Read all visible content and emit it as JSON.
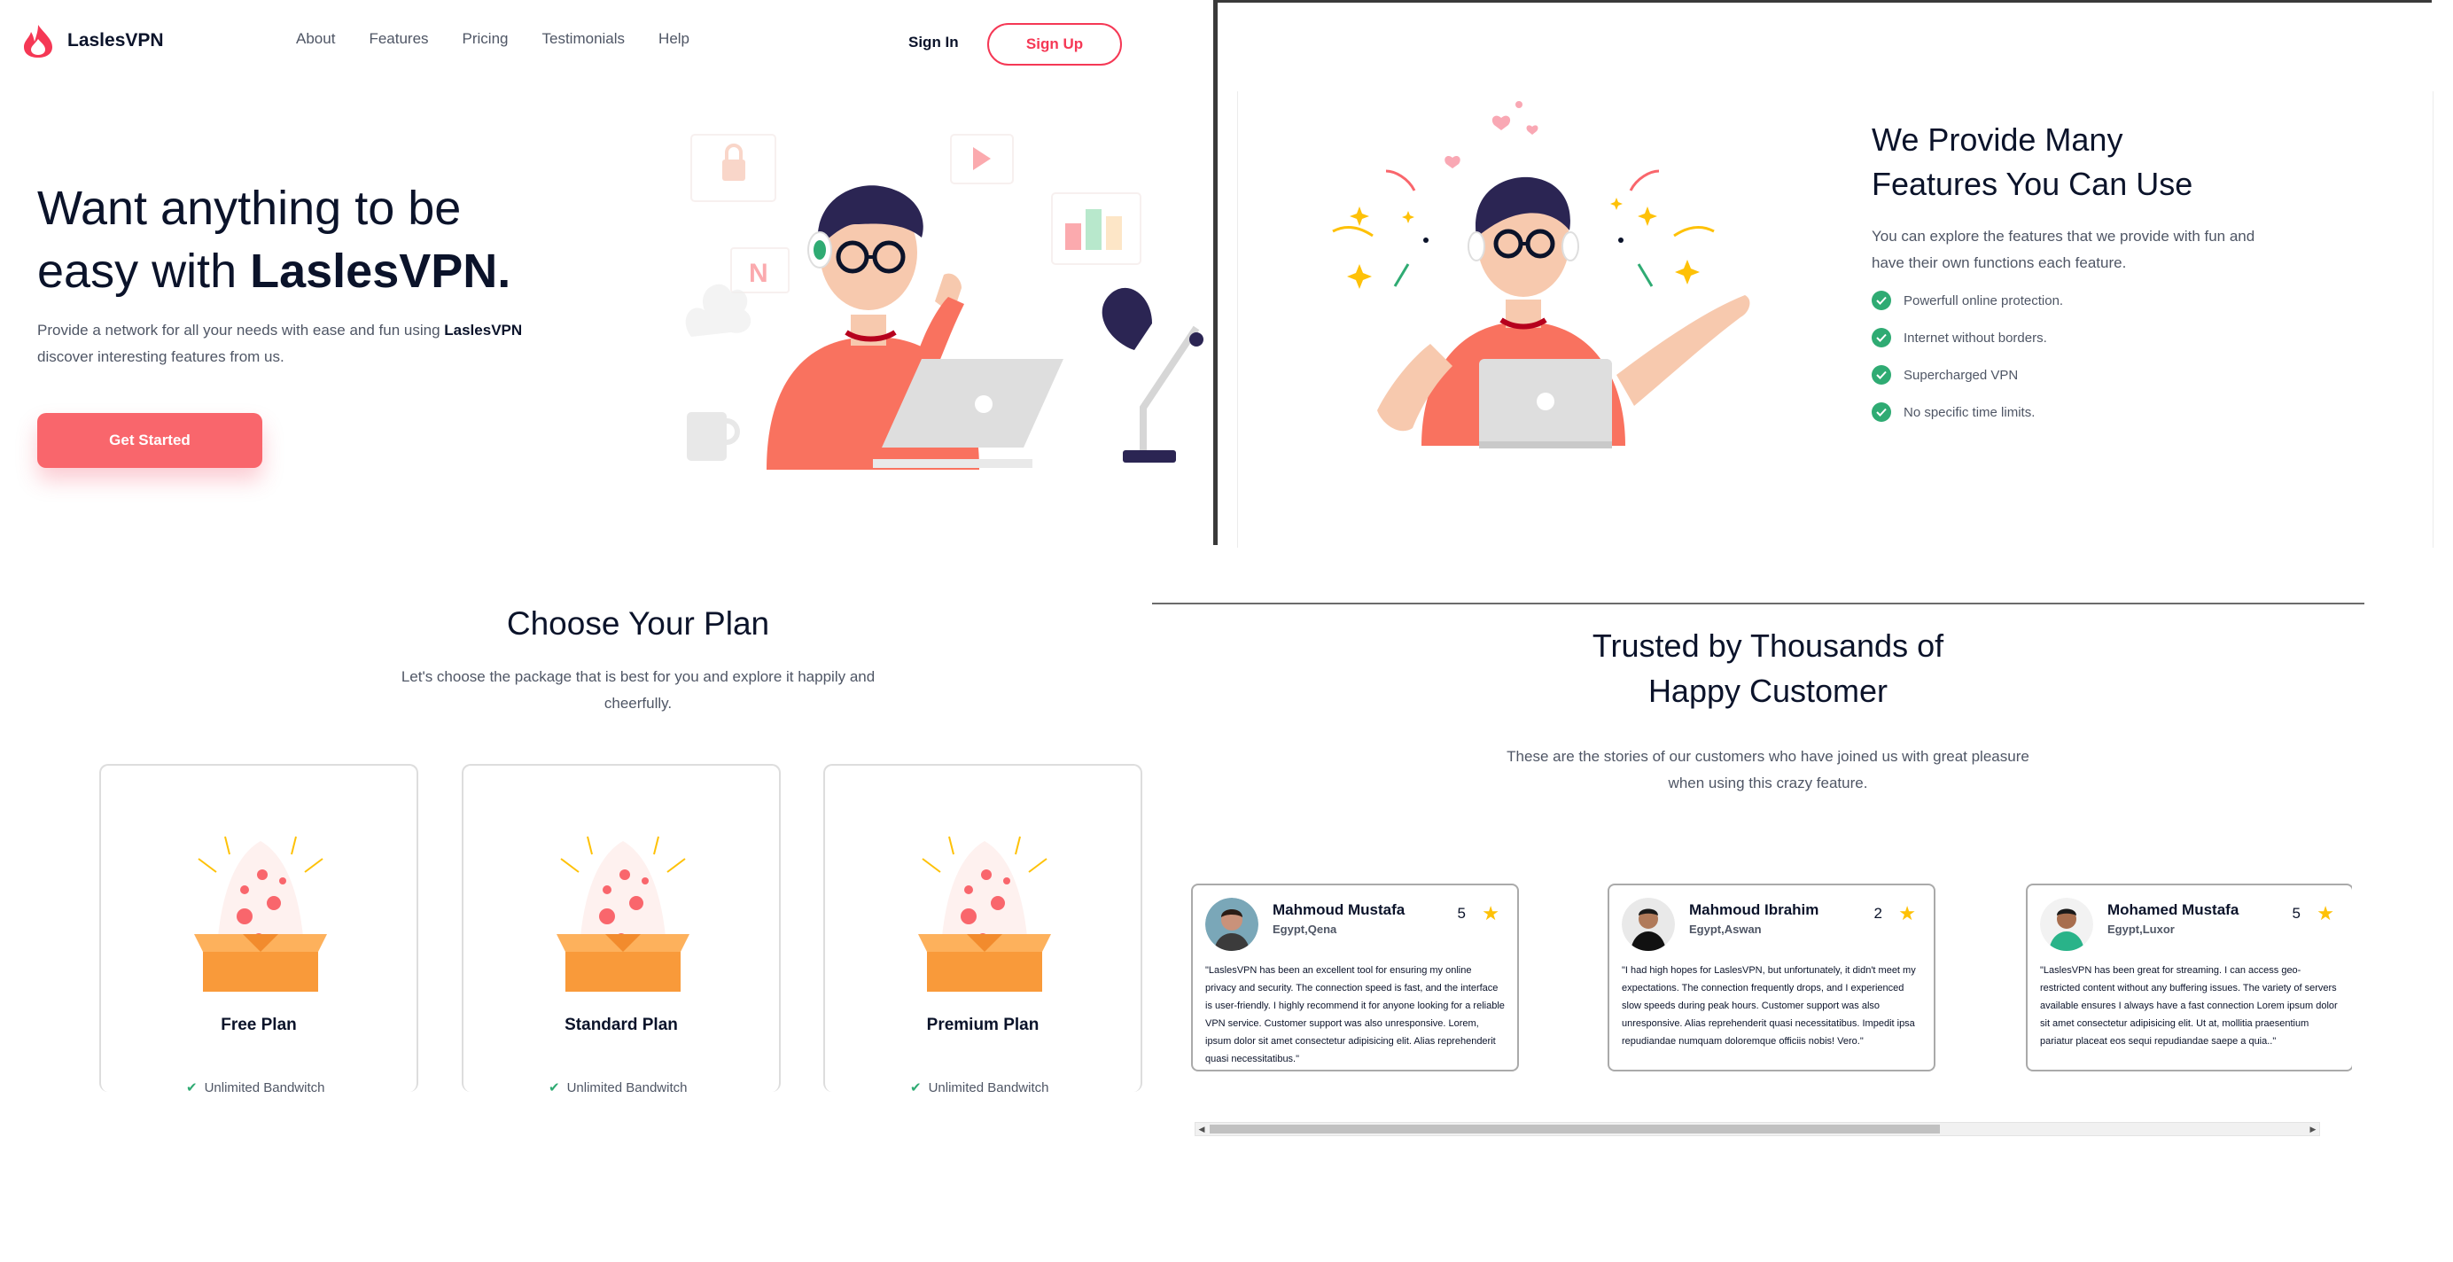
{
  "header": {
    "brand_name": "LaslesVPN",
    "nav": [
      "About",
      "Features",
      "Pricing",
      "Testimonials",
      "Help"
    ],
    "sign_in": "Sign In",
    "sign_up": "Sign Up"
  },
  "hero": {
    "title_line1": "Want anything to be",
    "title_line2_prefix": "easy with ",
    "title_line2_brand": "LaslesVPN.",
    "desc_prefix": "Provide a network for all your needs with ease and fun using ",
    "desc_brand": "LaslesVPN",
    "desc_line2": "discover interesting features from us.",
    "cta": "Get Started",
    "art_letter": "N"
  },
  "features": {
    "title_line1": "We Provide Many",
    "title_line2": "Features You Can Use",
    "desc": "You can explore the features that we provide with fun and have their own functions each feature.",
    "items": [
      "Powerfull online protection.",
      "Internet without borders.",
      "Supercharged VPN",
      "No specific time limits."
    ]
  },
  "pricing": {
    "title": "Choose Your Plan",
    "subtitle": "Let's choose the package that is best for you and explore it happily and cheerfully.",
    "plans": [
      {
        "name": "Free Plan",
        "feature": "Unlimited Bandwitch"
      },
      {
        "name": "Standard Plan",
        "feature": "Unlimited Bandwitch"
      },
      {
        "name": "Premium Plan",
        "feature": "Unlimited Bandwitch"
      }
    ]
  },
  "testimonials": {
    "title_line1": "Trusted by Thousands of",
    "title_line2": "Happy Customer",
    "subtitle": "These are the stories of our customers who have joined us with great pleasure when using this crazy feature.",
    "reviews": [
      {
        "name": "Mahmoud Mustafa",
        "location": "Egypt,Qena",
        "score": "5",
        "quote": "\"LaslesVPN has been an excellent tool for ensuring my online privacy and security. The connection speed is fast, and the interface is user-friendly. I highly recommend it for anyone looking for a reliable VPN service. Customer support was also unresponsive. Lorem, ipsum dolor sit amet consectetur adipisicing elit. Alias reprehenderit quasi necessitatibus.\""
      },
      {
        "name": "Mahmoud Ibrahim",
        "location": "Egypt,Aswan",
        "score": "2",
        "quote": "\"I had high hopes for LaslesVPN, but unfortunately, it didn't meet my expectations. The connection frequently drops, and I experienced slow speeds during peak hours. Customer support was also unresponsive. Alias reprehenderit quasi necessitatibus. Impedit ipsa repudiandae numquam doloremque officiis nobis! Vero.\""
      },
      {
        "name": "Mohamed Mustafa",
        "location": "Egypt,Luxor",
        "score": "5",
        "quote": "\"LaslesVPN has been great for streaming. I can access geo-restricted content without any buffering issues. The variety of servers available ensures I always have a fast connection Lorem ipsum dolor sit amet consectetur adipisicing elit. Ut at, mollitia praesentium pariatur placeat eos sequi repudiandae saepe a quia..\""
      }
    ]
  },
  "colors": {
    "accent": "#f53855",
    "cta": "#f9666c",
    "check": "#2fab73",
    "star": "#fec107",
    "navy": "#0b132a"
  }
}
